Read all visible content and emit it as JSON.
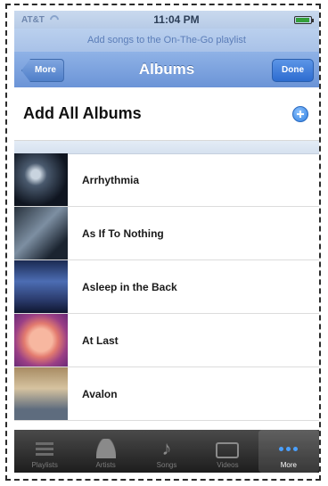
{
  "status_bar": {
    "carrier": "AT&T",
    "time": "11:04 PM"
  },
  "prompt": "Add songs to the On-The-Go playlist",
  "navbar": {
    "back_label": "More",
    "title": "Albums",
    "done_label": "Done"
  },
  "add_all": {
    "label": "Add All Albums",
    "icon": "plus-circle-icon"
  },
  "albums": [
    {
      "title": "Arrhythmia"
    },
    {
      "title": "As If To Nothing"
    },
    {
      "title": "Asleep in the Back"
    },
    {
      "title": "At Last"
    },
    {
      "title": "Avalon"
    }
  ],
  "tabbar": {
    "tabs": [
      {
        "label": "Playlists",
        "icon": "playlists-icon"
      },
      {
        "label": "Artists",
        "icon": "artists-icon"
      },
      {
        "label": "Songs",
        "icon": "songs-icon"
      },
      {
        "label": "Videos",
        "icon": "videos-icon"
      },
      {
        "label": "More",
        "icon": "more-icon",
        "selected": true
      }
    ]
  }
}
